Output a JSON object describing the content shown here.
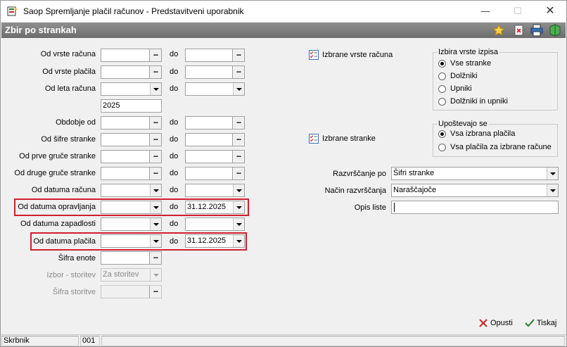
{
  "window": {
    "title": "Saop Spremljanje plačil računov - Predstavitveni uporabnik",
    "minimize": "—",
    "maximize": "☐",
    "close": "✕"
  },
  "header": {
    "title": "Zbir po strankah"
  },
  "form": {
    "rows": [
      {
        "label": "Od vrste računa",
        "do": "do",
        "from": "",
        "to": ""
      },
      {
        "label": "Od vrste plačila",
        "do": "do",
        "from": "",
        "to": ""
      },
      {
        "label": "Od leta računa",
        "do": "do",
        "from": "",
        "to": "",
        "year": "2025"
      },
      {
        "label": "Obdobje od",
        "do": "do",
        "from": "",
        "to": ""
      },
      {
        "label": "Od šifre stranke",
        "do": "do",
        "from": "",
        "to": ""
      },
      {
        "label": "Od prve gruče stranke",
        "do": "do",
        "from": "",
        "to": ""
      },
      {
        "label": "Od druge gruče stranke",
        "do": "do",
        "from": "",
        "to": ""
      },
      {
        "label": "Od datuma računa",
        "do": "do",
        "from": "",
        "to": ""
      },
      {
        "label": "Od datuma opravljanja",
        "do": "do",
        "from": "",
        "to": "31.12.2025"
      },
      {
        "label": "Od datuma zapadlosti",
        "do": "do",
        "from": "",
        "to": ""
      },
      {
        "label": "Od datuma plačila",
        "do": "do",
        "from": "",
        "to": "31.12.2025"
      },
      {
        "label": "Šifra enote",
        "from": ""
      },
      {
        "label": "Izbor - storitev",
        "from": "Za storitev"
      },
      {
        "label": "Šifra storitve",
        "from": ""
      }
    ]
  },
  "right": {
    "izbrane_vrste": "Izbrane vrste računa",
    "izbrane_stranke": "Izbrane stranke",
    "izbira_group": {
      "title": "Izbira vrste izpisa",
      "options": [
        "Vse stranke",
        "Dolžniki",
        "Upniki",
        "Dolžniki in upniki"
      ],
      "selected": 0
    },
    "upostevajo_group": {
      "title": "Upoštevajo se",
      "options": [
        "Vsa izbrana plačila",
        "Vsa plačila za izbrane račune"
      ],
      "selected": 0
    },
    "razvrscanje_label": "Razvrščanje po",
    "razvrscanje_value": "Šifri stranke",
    "nacin_label": "Način razvrščanja",
    "nacin_value": "Naraščajoče",
    "opis_label": "Opis liste",
    "opis_value": ""
  },
  "buttons": {
    "cancel": "Opusti",
    "print": "Tiskaj"
  },
  "status": {
    "left": "Skrbnik",
    "code": "001"
  },
  "colors": {
    "highlight": "#d11f2d",
    "header_band": "#7a7a7a"
  }
}
